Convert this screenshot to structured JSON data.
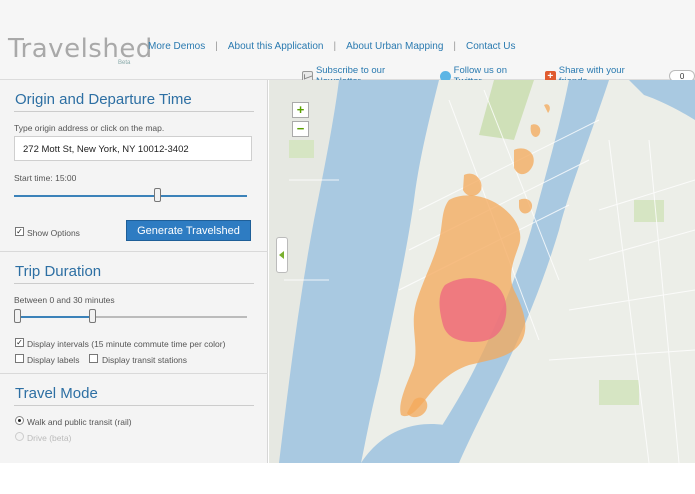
{
  "header": {
    "logo": "Travelshed",
    "beta": "Beta",
    "nav": [
      "More Demos",
      "About this Application",
      "About Urban Mapping",
      "Contact Us"
    ],
    "social": {
      "newsletter": "Subscribe to our Newsletter",
      "twitter": "Follow us on Twitter",
      "share": "Share with your friends",
      "share_count": "0"
    }
  },
  "origin": {
    "title": "Origin and Departure Time",
    "hint": "Type origin address or click on the map.",
    "address": "272 Mott St, New York, NY  10012-3402",
    "start_label": "Start time: 15:00",
    "start_fraction": 0.62,
    "show_options_label": "Show Options",
    "show_options_checked": true,
    "generate_label": "Generate Travelshed"
  },
  "trip": {
    "title": "Trip Duration",
    "range_label": "Between 0 and 30 minutes",
    "range_min_fraction": 0.0,
    "range_max_fraction": 0.33,
    "intervals_label": "Display intervals (15 minute commute time per color)",
    "intervals_checked": true,
    "labels_label": "Display labels",
    "labels_checked": false,
    "transit_label": "Display transit stations",
    "transit_checked": false
  },
  "mode": {
    "title": "Travel Mode",
    "options": [
      "Walk and public transit (rail)",
      "Drive (beta)"
    ],
    "selected": 0
  },
  "map": {
    "zoom_in": "+",
    "zoom_out": "−",
    "colors": {
      "water": "#a8c8e0",
      "land": "#eceee8",
      "park": "#cfe0b8",
      "zone_outer": "#f4a85a",
      "zone_inner": "#ee6a80"
    }
  }
}
